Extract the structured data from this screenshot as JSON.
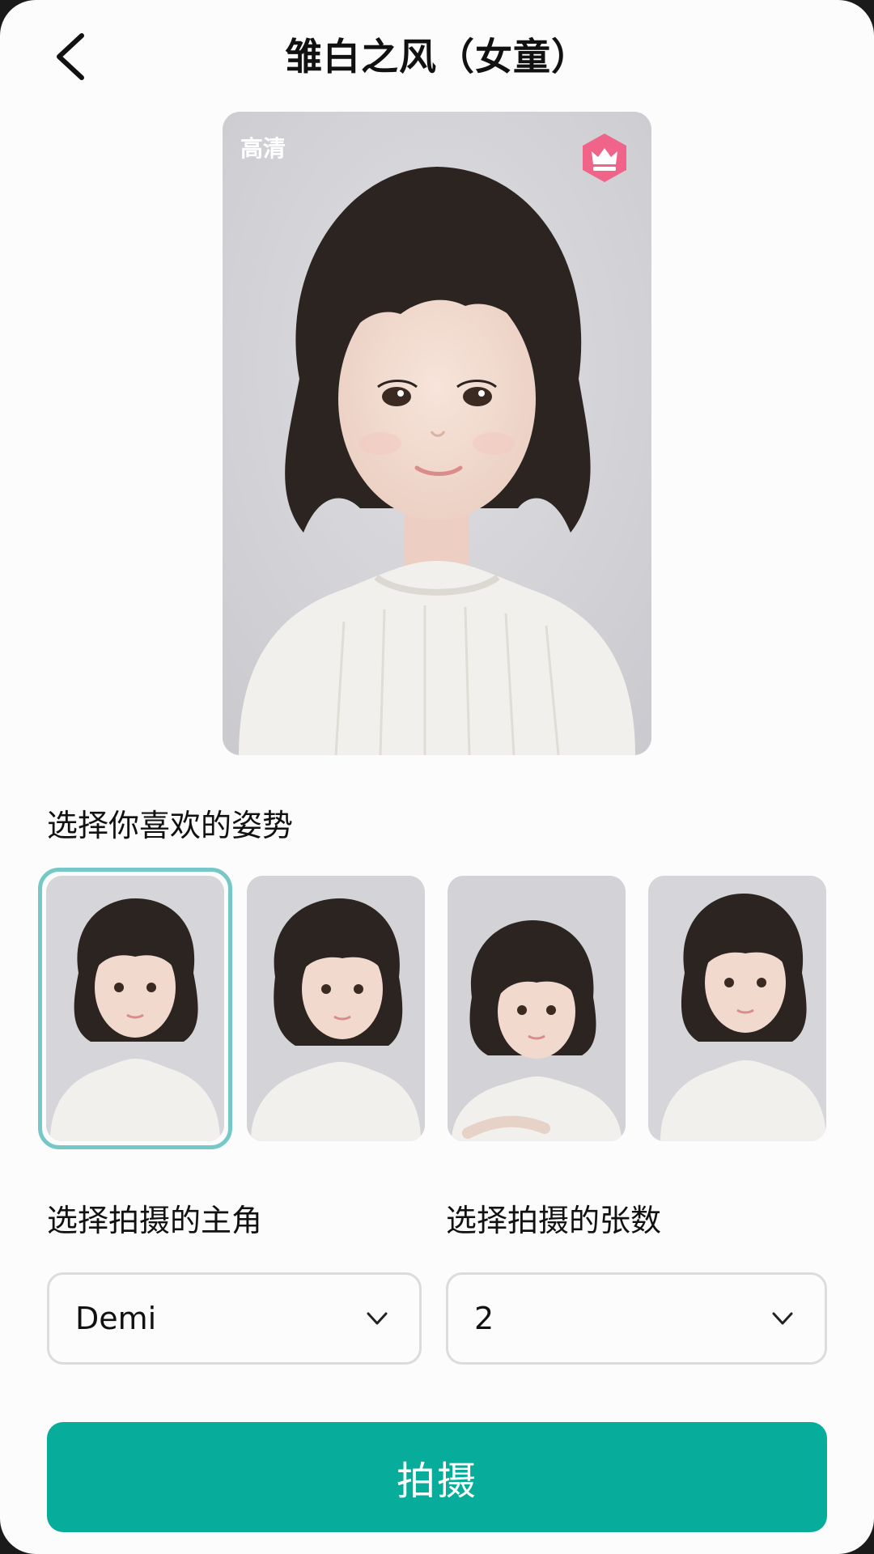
{
  "header": {
    "title": "雏白之风（女童）"
  },
  "preview": {
    "hd_label": "高清",
    "premium_icon": "crown-icon"
  },
  "pose_section": {
    "label": "选择你喜欢的姿势",
    "selected_index": 0,
    "poses": [
      {
        "name": "pose-1"
      },
      {
        "name": "pose-2"
      },
      {
        "name": "pose-3"
      },
      {
        "name": "pose-4"
      }
    ]
  },
  "subject_section": {
    "label": "选择拍摄的主角",
    "value": "Demi"
  },
  "count_section": {
    "label": "选择拍摄的张数",
    "value": "2"
  },
  "action": {
    "shoot_label": "拍摄"
  },
  "colors": {
    "accent": "#07ad9a",
    "selection_ring": "#76c8c8",
    "premium_badge": "#f0648a"
  }
}
